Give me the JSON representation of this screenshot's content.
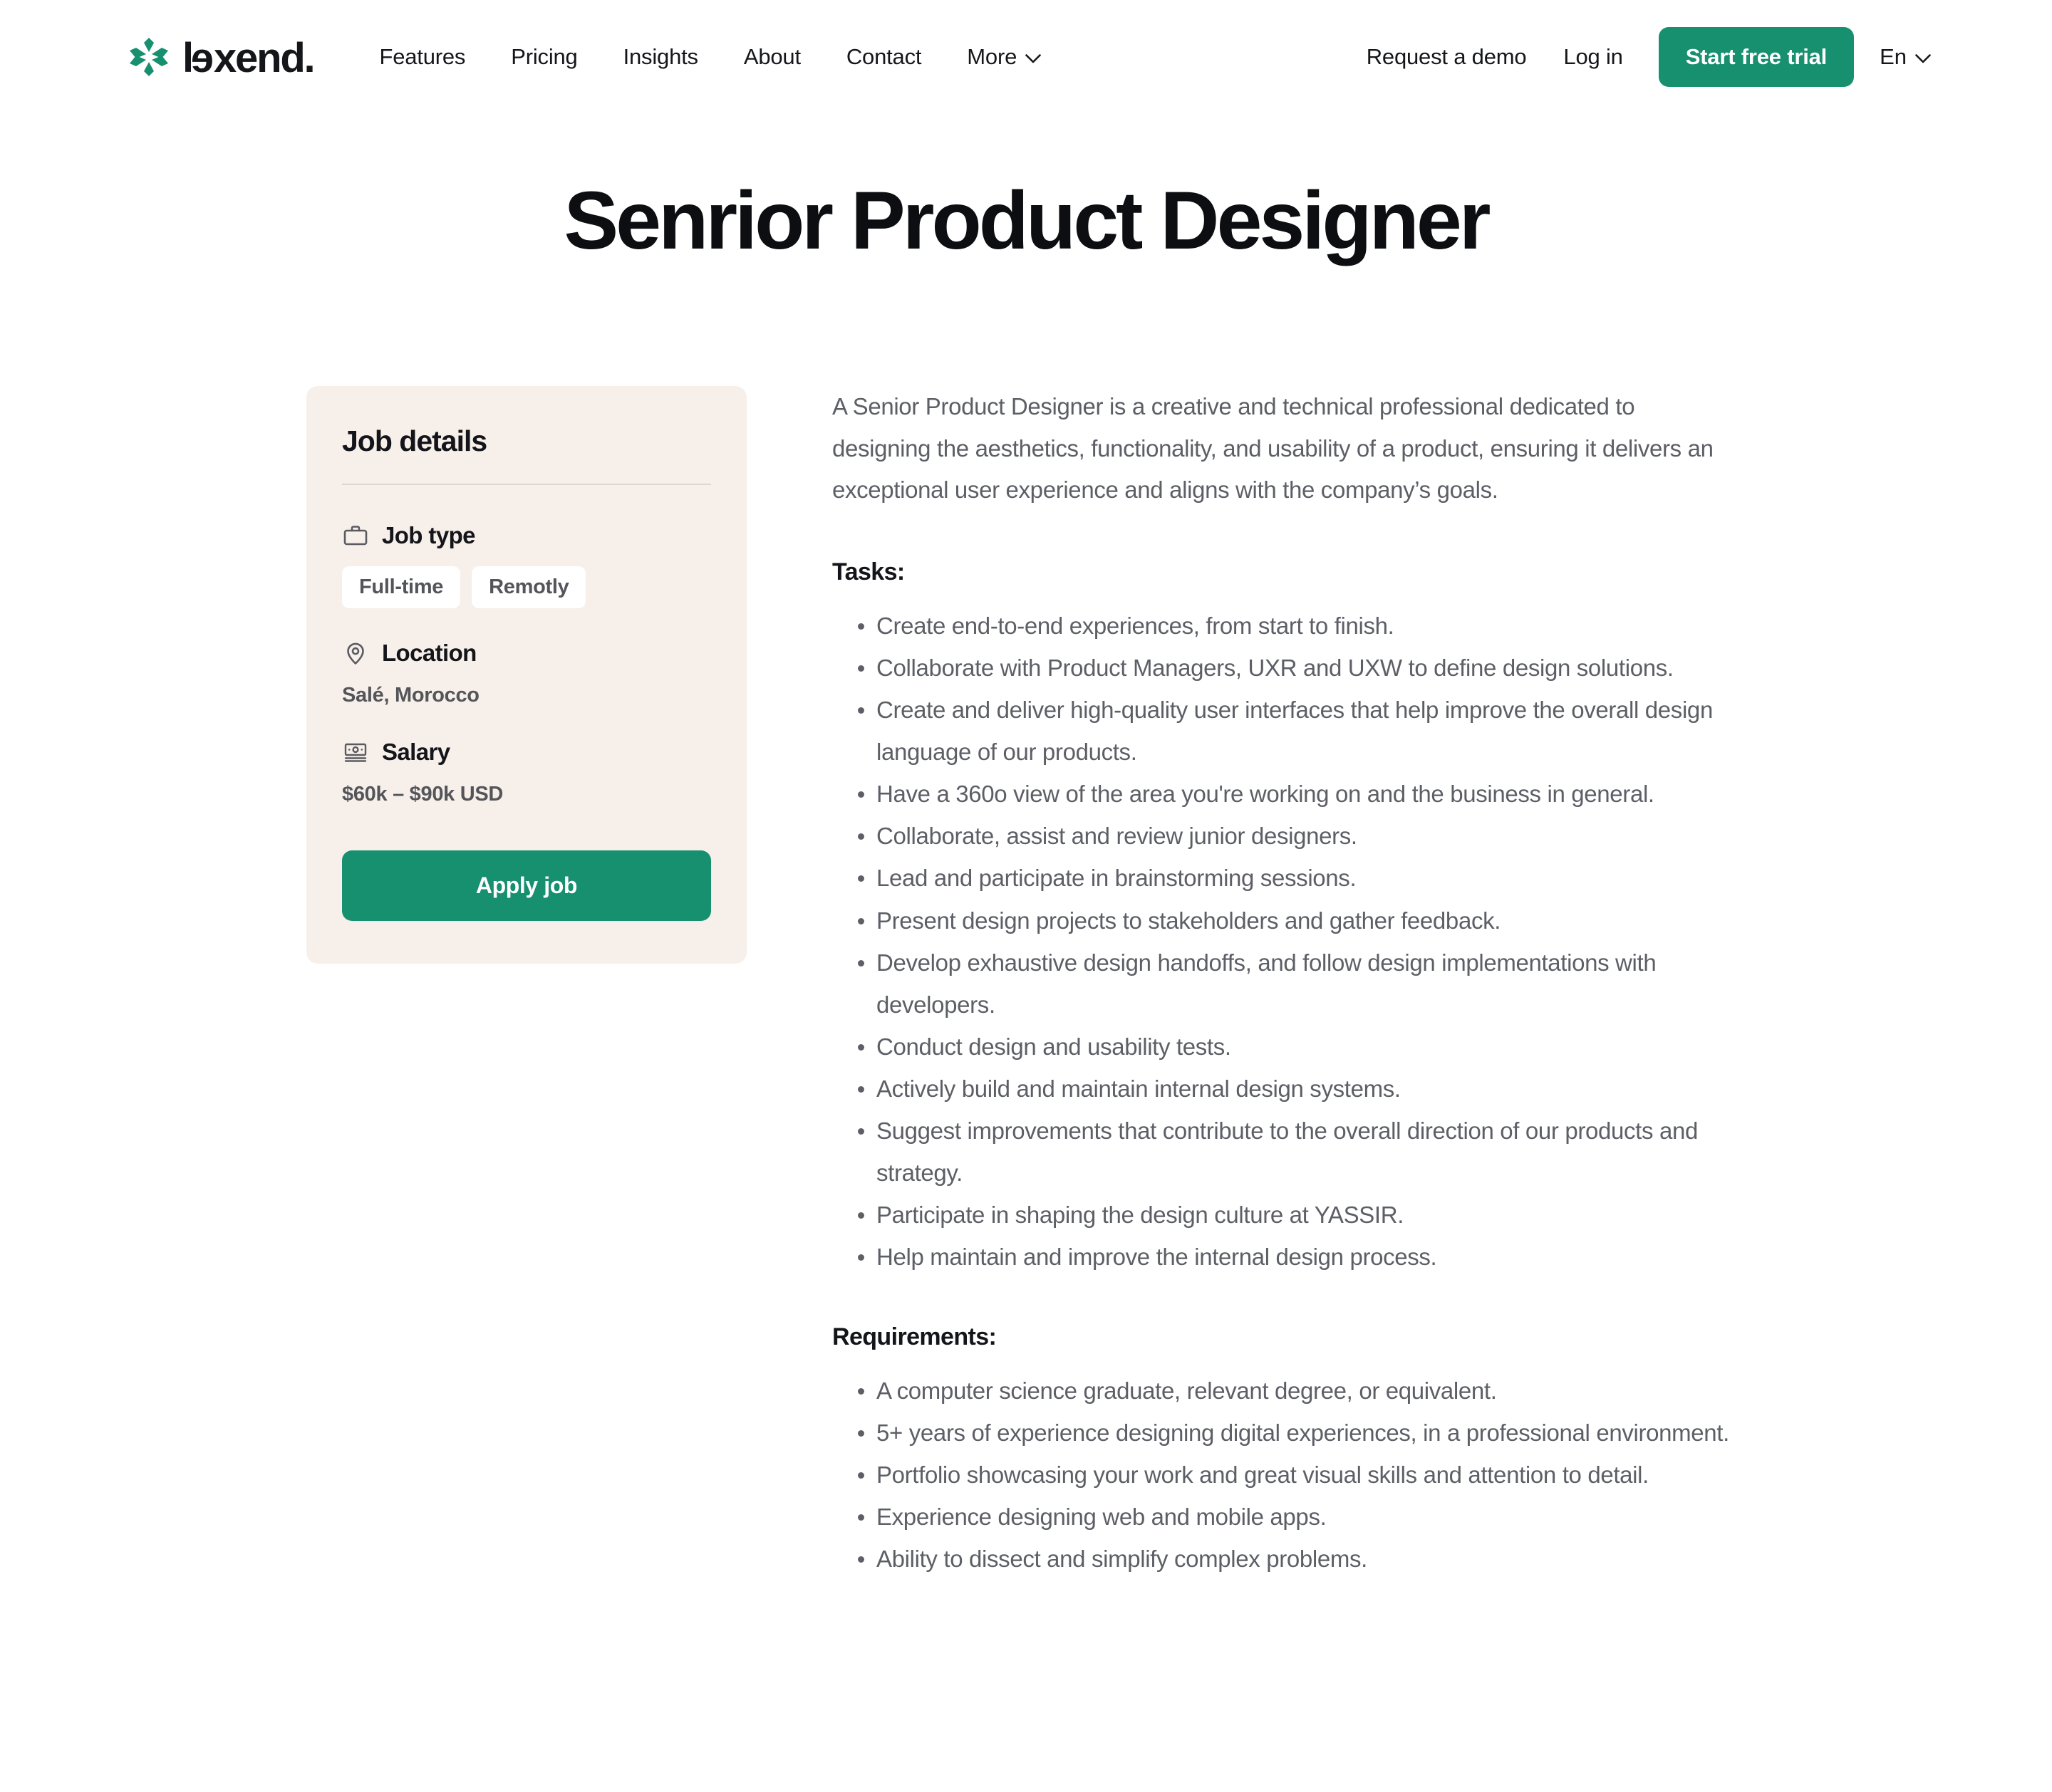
{
  "brand": {
    "name_part1": "l",
    "name_flip": "e",
    "name_part2": "xend.",
    "logo_icon": "asterisk-star-icon",
    "accent": "#179070"
  },
  "nav": {
    "links": [
      {
        "label": "Features",
        "caret": false
      },
      {
        "label": "Pricing",
        "caret": false
      },
      {
        "label": "Insights",
        "caret": false
      },
      {
        "label": "About",
        "caret": false
      },
      {
        "label": "Contact",
        "caret": false
      },
      {
        "label": "More",
        "caret": true
      }
    ],
    "request_demo": "Request a demo",
    "log_in": "Log in",
    "start_free_trial": "Start free trial",
    "language": "En"
  },
  "page": {
    "title": "Senrior Product Designer"
  },
  "job_card": {
    "title": "Job details",
    "job_type": {
      "label": "Job type",
      "icon": "briefcase-icon",
      "tags": [
        "Full-time",
        "Remotly"
      ]
    },
    "location": {
      "label": "Location",
      "icon": "map-pin-icon",
      "value": "Salé, Morocco"
    },
    "salary": {
      "label": "Salary",
      "icon": "banknote-icon",
      "value": "$60k – $90k USD"
    },
    "apply_label": "Apply job",
    "background": "#F7EFEA"
  },
  "job_body": {
    "intro": "A Senior Product Designer is a creative and technical professional dedicated to designing the aesthetics, functionality, and usability of a product, ensuring it delivers an exceptional user experience and aligns with the company’s goals.",
    "tasks_heading": "Tasks:",
    "tasks": [
      "Create end-to-end experiences, from start to finish.",
      "Collaborate with Product Managers, UXR and UXW to define design solutions.",
      "Create and deliver high-quality user interfaces that help improve the overall design language of our products.",
      "Have a 360o view of the area you're working on and the business in general.",
      "Collaborate, assist and review junior designers.",
      "Lead and participate in brainstorming sessions.",
      "Present design projects to stakeholders and gather feedback.",
      "Develop exhaustive design handoffs, and follow design implementations with developers.",
      "Conduct design and usability tests.",
      "Actively build and maintain internal design systems.",
      "Suggest improvements that contribute to the overall direction of our products and strategy.",
      "Participate in shaping the design culture at YASSIR.",
      "Help maintain and improve the internal design process."
    ],
    "requirements_heading": "Requirements:",
    "requirements": [
      "A computer science graduate, relevant degree, or equivalent.",
      "5+ years of experience designing digital experiences, in a professional environment.",
      "Portfolio showcasing your work and great visual skills and attention to detail.",
      "Experience designing web and mobile apps.",
      "Ability to dissect and simplify complex problems."
    ]
  }
}
